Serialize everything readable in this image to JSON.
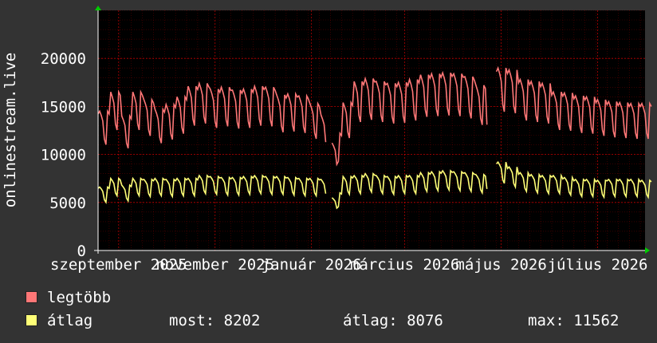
{
  "chart_data": {
    "type": "line",
    "ylabel": "onlinestream.live",
    "ylim": [
      0,
      25000
    ],
    "yticks": [
      0,
      5000,
      10000,
      15000,
      20000
    ],
    "ytick_labels": [
      "0",
      "5000",
      "10000",
      "15000",
      "20000"
    ],
    "xlim": [
      "2025-08-19",
      "2026-07-31"
    ],
    "xticks": [
      {
        "date": "2025-09-01",
        "label": "szeptember 2025"
      },
      {
        "date": "2025-11-01",
        "label": "november 2025"
      },
      {
        "date": "2026-01-01",
        "label": "január 2026"
      },
      {
        "date": "2026-03-01",
        "label": "március 2026"
      },
      {
        "date": "2026-05-01",
        "label": "május 2026"
      },
      {
        "date": "2026-07-01",
        "label": "július 2026"
      }
    ],
    "grid": true,
    "background": "#000000",
    "grid_color": "#ff0000",
    "series": [
      {
        "name": "legtöbb",
        "color": "#ff7777",
        "weekly": [
          [
            14500,
            8.0
          ],
          [
            16500,
            7.0
          ],
          [
            14000,
            7.0
          ],
          [
            16500,
            7.0
          ],
          [
            15700,
            7.0
          ],
          [
            14700,
            7.0
          ],
          [
            15200,
            7.0
          ],
          [
            16000,
            7.0
          ],
          [
            17100,
            7.0
          ],
          [
            17400,
            7.0
          ],
          [
            16800,
            7.0
          ],
          [
            17000,
            7.0
          ],
          [
            16700,
            7.0
          ],
          [
            16800,
            7.0
          ],
          [
            17100,
            7.0
          ],
          [
            17000,
            7.0
          ],
          [
            16200,
            7.0
          ],
          [
            16300,
            7.0
          ],
          [
            16100,
            7.0
          ],
          [
            15300,
            7.0
          ],
          [
            14100,
            4.0
          ],
          [
            null,
            3.0
          ],
          [
            11200,
            4.0
          ],
          [
            12200,
            3.0
          ],
          [
            15400,
            7.0
          ],
          [
            17600,
            7.0
          ],
          [
            17900,
            7.0
          ],
          [
            17600,
            7.0
          ],
          [
            17400,
            7.0
          ],
          [
            17500,
            7.0
          ],
          [
            17800,
            7.0
          ],
          [
            18300,
            7.0
          ],
          [
            18400,
            7.0
          ],
          [
            18500,
            7.0
          ],
          [
            18400,
            7.0
          ],
          [
            18100,
            7.0
          ],
          [
            17200,
            7.0
          ],
          [
            13100,
            1.0
          ],
          [
            null,
            5.0
          ],
          [
            19000,
            7.0
          ],
          [
            18800,
            7.0
          ],
          [
            17800,
            7.0
          ],
          [
            17600,
            7.0
          ],
          [
            17400,
            7.0
          ],
          [
            16500,
            7.0
          ],
          [
            16400,
            7.0
          ],
          [
            16100,
            7.0
          ],
          [
            16000,
            7.0
          ],
          [
            15700,
            7.0
          ],
          [
            15500,
            7.0
          ],
          [
            15400,
            7.0
          ],
          [
            15300,
            7.0
          ],
          [
            15300,
            8.0
          ]
        ]
      },
      {
        "name": "átlag",
        "color": "#ffff77",
        "weekly": [
          [
            6600,
            8.0
          ],
          [
            7500,
            7.0
          ],
          [
            6800,
            7.0
          ],
          [
            7500,
            7.0
          ],
          [
            7400,
            7.0
          ],
          [
            7500,
            7.0
          ],
          [
            7400,
            7.0
          ],
          [
            7500,
            7.0
          ],
          [
            7500,
            7.0
          ],
          [
            7800,
            7.0
          ],
          [
            7700,
            7.0
          ],
          [
            7600,
            7.0
          ],
          [
            7600,
            7.0
          ],
          [
            7700,
            7.0
          ],
          [
            7800,
            7.0
          ],
          [
            7700,
            7.0
          ],
          [
            7700,
            7.0
          ],
          [
            7600,
            7.0
          ],
          [
            7500,
            7.0
          ],
          [
            7500,
            7.0
          ],
          [
            7400,
            4.0
          ],
          [
            null,
            3.0
          ],
          [
            5500,
            4.0
          ],
          [
            6000,
            3.0
          ],
          [
            7700,
            7.0
          ],
          [
            7800,
            7.0
          ],
          [
            8000,
            7.0
          ],
          [
            7800,
            7.0
          ],
          [
            7700,
            7.0
          ],
          [
            7800,
            7.0
          ],
          [
            7800,
            7.0
          ],
          [
            8100,
            7.0
          ],
          [
            8200,
            7.0
          ],
          [
            8300,
            7.0
          ],
          [
            8200,
            7.0
          ],
          [
            8100,
            7.0
          ],
          [
            7900,
            7.0
          ],
          [
            6400,
            1.0
          ],
          [
            null,
            5.0
          ],
          [
            9200,
            7.0
          ],
          [
            8700,
            7.0
          ],
          [
            8100,
            7.0
          ],
          [
            7900,
            7.0
          ],
          [
            7800,
            7.0
          ],
          [
            7800,
            7.0
          ],
          [
            7600,
            7.0
          ],
          [
            7400,
            7.0
          ],
          [
            7400,
            7.0
          ],
          [
            7300,
            7.0
          ],
          [
            7400,
            7.0
          ],
          [
            7400,
            7.0
          ],
          [
            7400,
            7.0
          ],
          [
            7300,
            8.0
          ]
        ]
      }
    ]
  },
  "legend": {
    "items": [
      {
        "label": "legtöbb",
        "color": "#ff7777"
      },
      {
        "label": "átlag",
        "color": "#ffff77"
      }
    ],
    "stats": {
      "most": "most: 8202",
      "atlag": "átlag: 8076",
      "max": "max: 11562"
    }
  }
}
